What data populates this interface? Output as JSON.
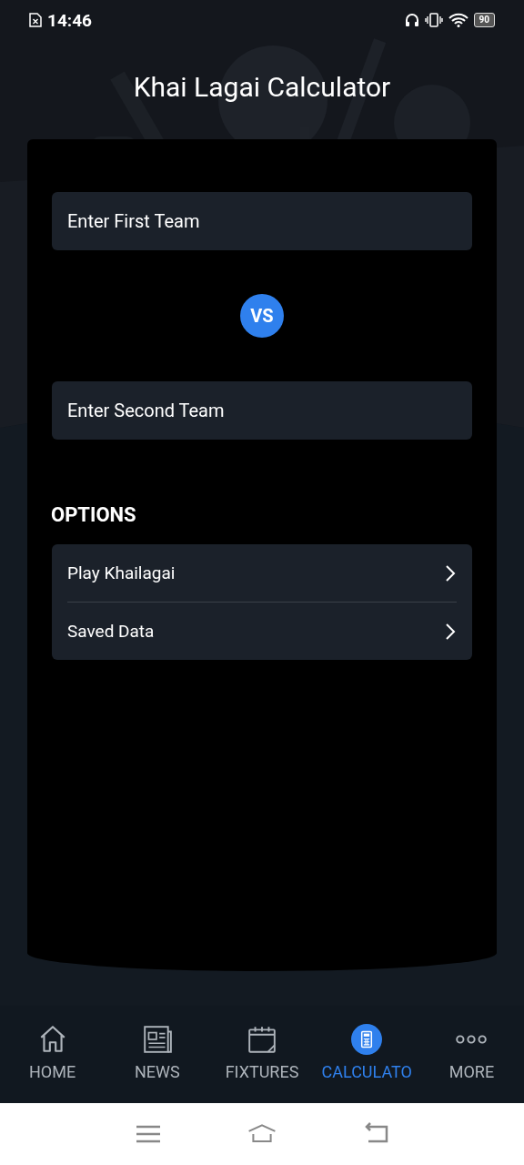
{
  "status_bar": {
    "time": "14:46",
    "battery": "90"
  },
  "header": {
    "title": "Khai Lagai Calculator",
    "kind": "picture"
  },
  "form": {
    "first_team": {
      "placeholder": "Enter First Team"
    },
    "vs": "VS",
    "second_team": {
      "placeholder": "Enter Second Team"
    }
  },
  "options": {
    "heading": "OPTIONS",
    "items": [
      {
        "label": "Play Khailagai"
      },
      {
        "label": "Saved Data"
      }
    ]
  },
  "bottom_nav": [
    {
      "label": "HOME",
      "selected": false
    },
    {
      "label": "NEWS",
      "selected": false
    },
    {
      "label": "FIXTURES",
      "selected": false
    },
    {
      "label": "CALCULATO",
      "selected": true
    },
    {
      "label": "MORE",
      "selected": false
    }
  ]
}
